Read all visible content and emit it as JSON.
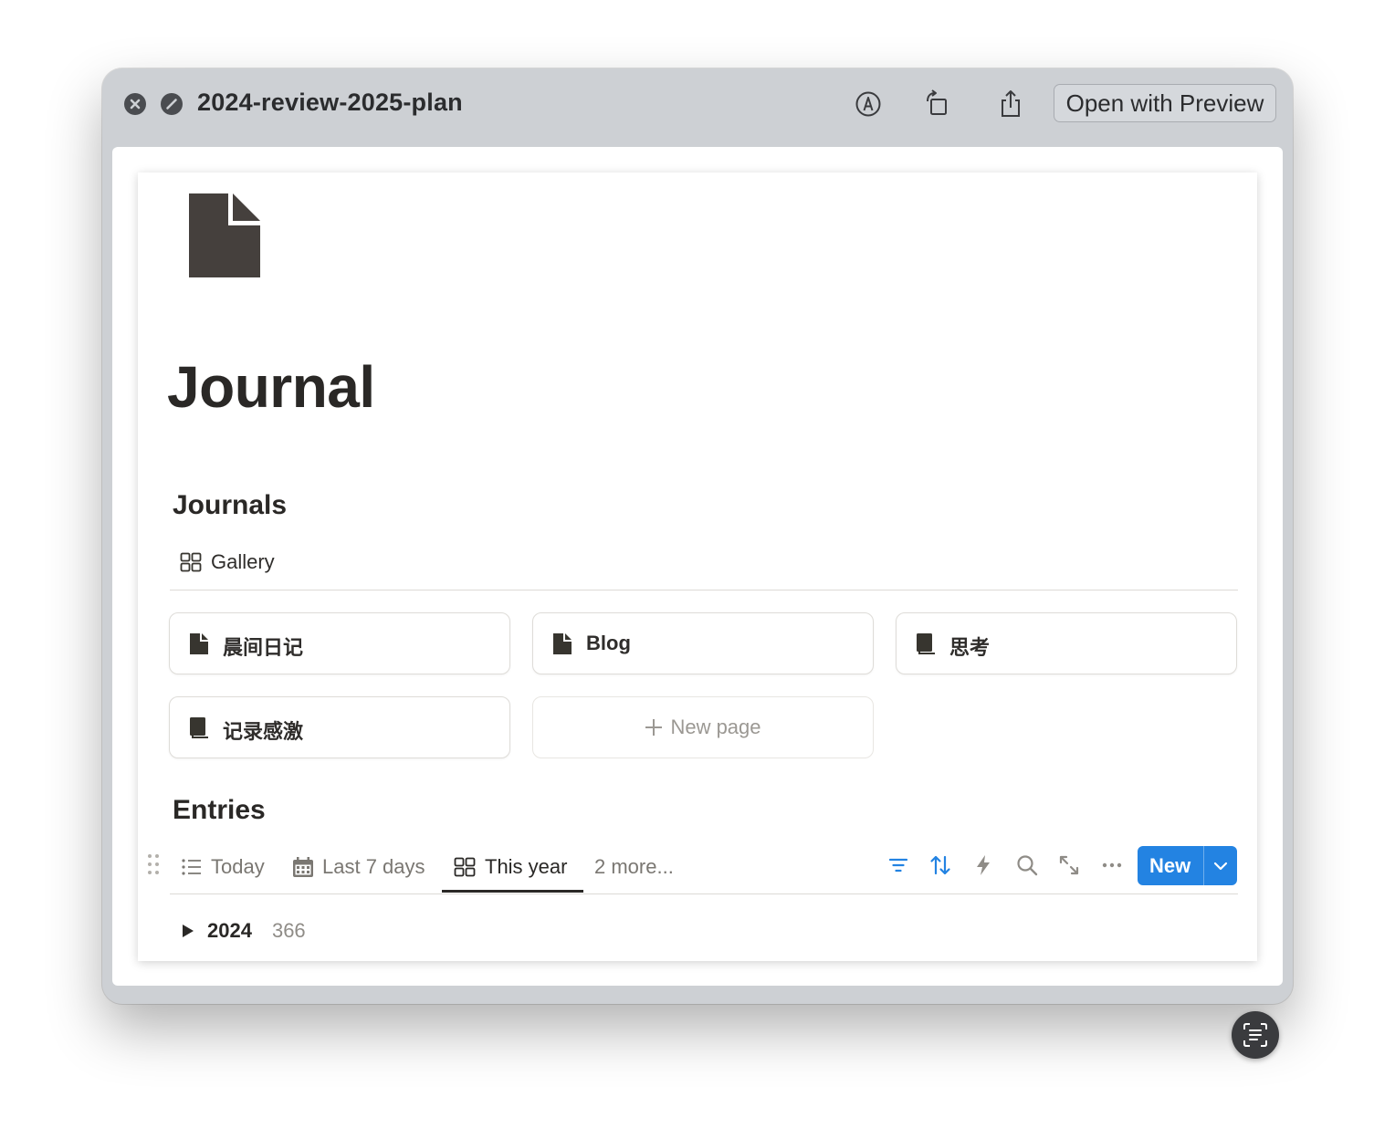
{
  "window": {
    "title": "2024-review-2025-plan",
    "open_button_label": "Open with Preview",
    "toolbar_icons": [
      "markup-icon",
      "rotate-icon",
      "share-icon"
    ]
  },
  "page": {
    "title": "Journal",
    "icon": "document-icon"
  },
  "journals": {
    "title": "Journals",
    "view_label": "Gallery",
    "view_icon": "gallery-grid-icon",
    "cards": [
      {
        "label": "晨间日记",
        "icon": "document-icon"
      },
      {
        "label": "Blog",
        "icon": "document-icon"
      },
      {
        "label": "思考",
        "icon": "notebook-icon"
      },
      {
        "label": "记录感激",
        "icon": "notebook-icon"
      }
    ],
    "new_page_label": "New page"
  },
  "entries": {
    "title": "Entries",
    "tabs": [
      {
        "label": "Today",
        "icon": "list-icon"
      },
      {
        "label": "Last 7 days",
        "icon": "calendar-icon"
      },
      {
        "label": "This year",
        "icon": "gallery-grid-icon",
        "active": true
      },
      {
        "label": "2 more..."
      }
    ],
    "toolbar_icons": [
      "filter-icon",
      "sort-icon",
      "automation-icon",
      "search-icon",
      "expand-icon",
      "more-icon"
    ],
    "new_button_label": "New",
    "groups": [
      {
        "label": "2024",
        "count": "366"
      }
    ]
  },
  "colors": {
    "accent": "#2383e2",
    "titlebar": "#cdd0d4",
    "text": "#2a2826"
  }
}
